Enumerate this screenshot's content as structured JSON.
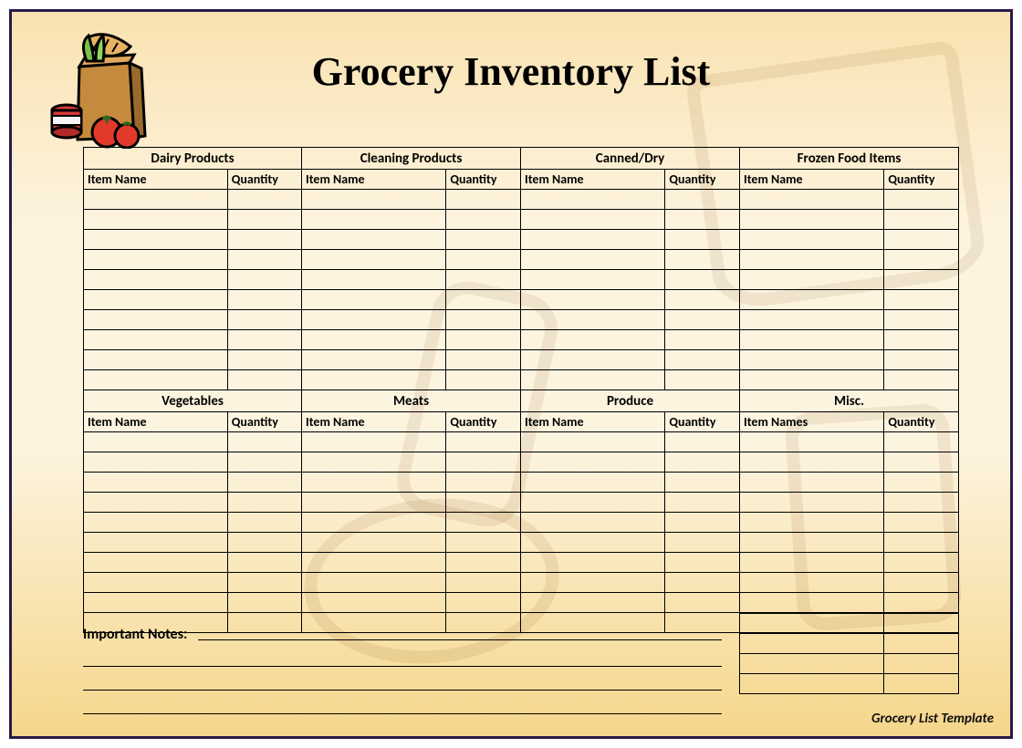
{
  "title": "Grocery Inventory List",
  "columns": {
    "item": "Item Name",
    "items_alt": "Item Names",
    "qty": "Quantity"
  },
  "categories_top": [
    {
      "title": "Dairy Products",
      "item_label_key": "item",
      "rows": 10
    },
    {
      "title": "Cleaning Products",
      "item_label_key": "item",
      "rows": 10
    },
    {
      "title": "Canned/Dry",
      "item_label_key": "item",
      "rows": 10
    },
    {
      "title": "Frozen Food Items",
      "item_label_key": "item",
      "rows": 10
    }
  ],
  "categories_bottom": [
    {
      "title": "Vegetables",
      "item_label_key": "item",
      "rows": 10
    },
    {
      "title": "Meats",
      "item_label_key": "item",
      "rows": 10
    },
    {
      "title": "Produce",
      "item_label_key": "item",
      "rows": 10
    },
    {
      "title": "Misc.",
      "item_label_key": "items_alt",
      "rows": 10
    }
  ],
  "misc_extra_rows": 4,
  "notes": {
    "label": "Important Notes:",
    "line_count": 4
  },
  "footer": "Grocery List Template"
}
